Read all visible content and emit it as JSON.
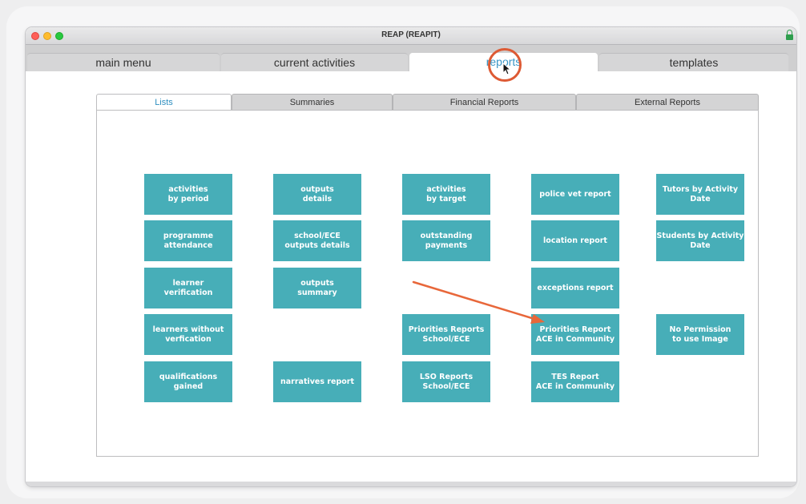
{
  "window": {
    "title": "REAP (REAPIT)"
  },
  "main_tabs": [
    {
      "label": "main menu"
    },
    {
      "label": "current activities"
    },
    {
      "label": "reports",
      "active": true
    },
    {
      "label": "templates"
    }
  ],
  "sub_tabs": [
    {
      "label": "Lists",
      "active": true
    },
    {
      "label": "Summaries"
    },
    {
      "label": "Financial Reports"
    },
    {
      "label": "External Reports"
    }
  ],
  "report_buttons": {
    "col1": [
      "activities\nby period",
      "programme\nattendance",
      "learner\nverification",
      "learners without\nverfication",
      "qualifications\ngained"
    ],
    "col2": [
      "outputs\ndetails",
      "school/ECE\noutputs details",
      "outputs\nsummary",
      "narratives report"
    ],
    "col3": [
      "activities\nby target",
      "outstanding\npayments",
      "Priorities Reports\nSchool/ECE",
      "LSO Reports\nSchool/ECE"
    ],
    "col4": [
      "police vet report",
      "location report",
      "exceptions report",
      "Priorities Report\nACE in Community",
      "TES Report\nACE in Community"
    ],
    "col5": [
      "Tutors by Activity\nDate",
      "Students by Activity\nDate",
      "No Permission\nto use Image"
    ]
  },
  "colors": {
    "button": "#47aeb8",
    "active_tab_text": "#3a96c7",
    "annotation": "#e8673a"
  },
  "icons": {
    "lock": "lock-icon",
    "cursor": "arrow-cursor-icon"
  }
}
